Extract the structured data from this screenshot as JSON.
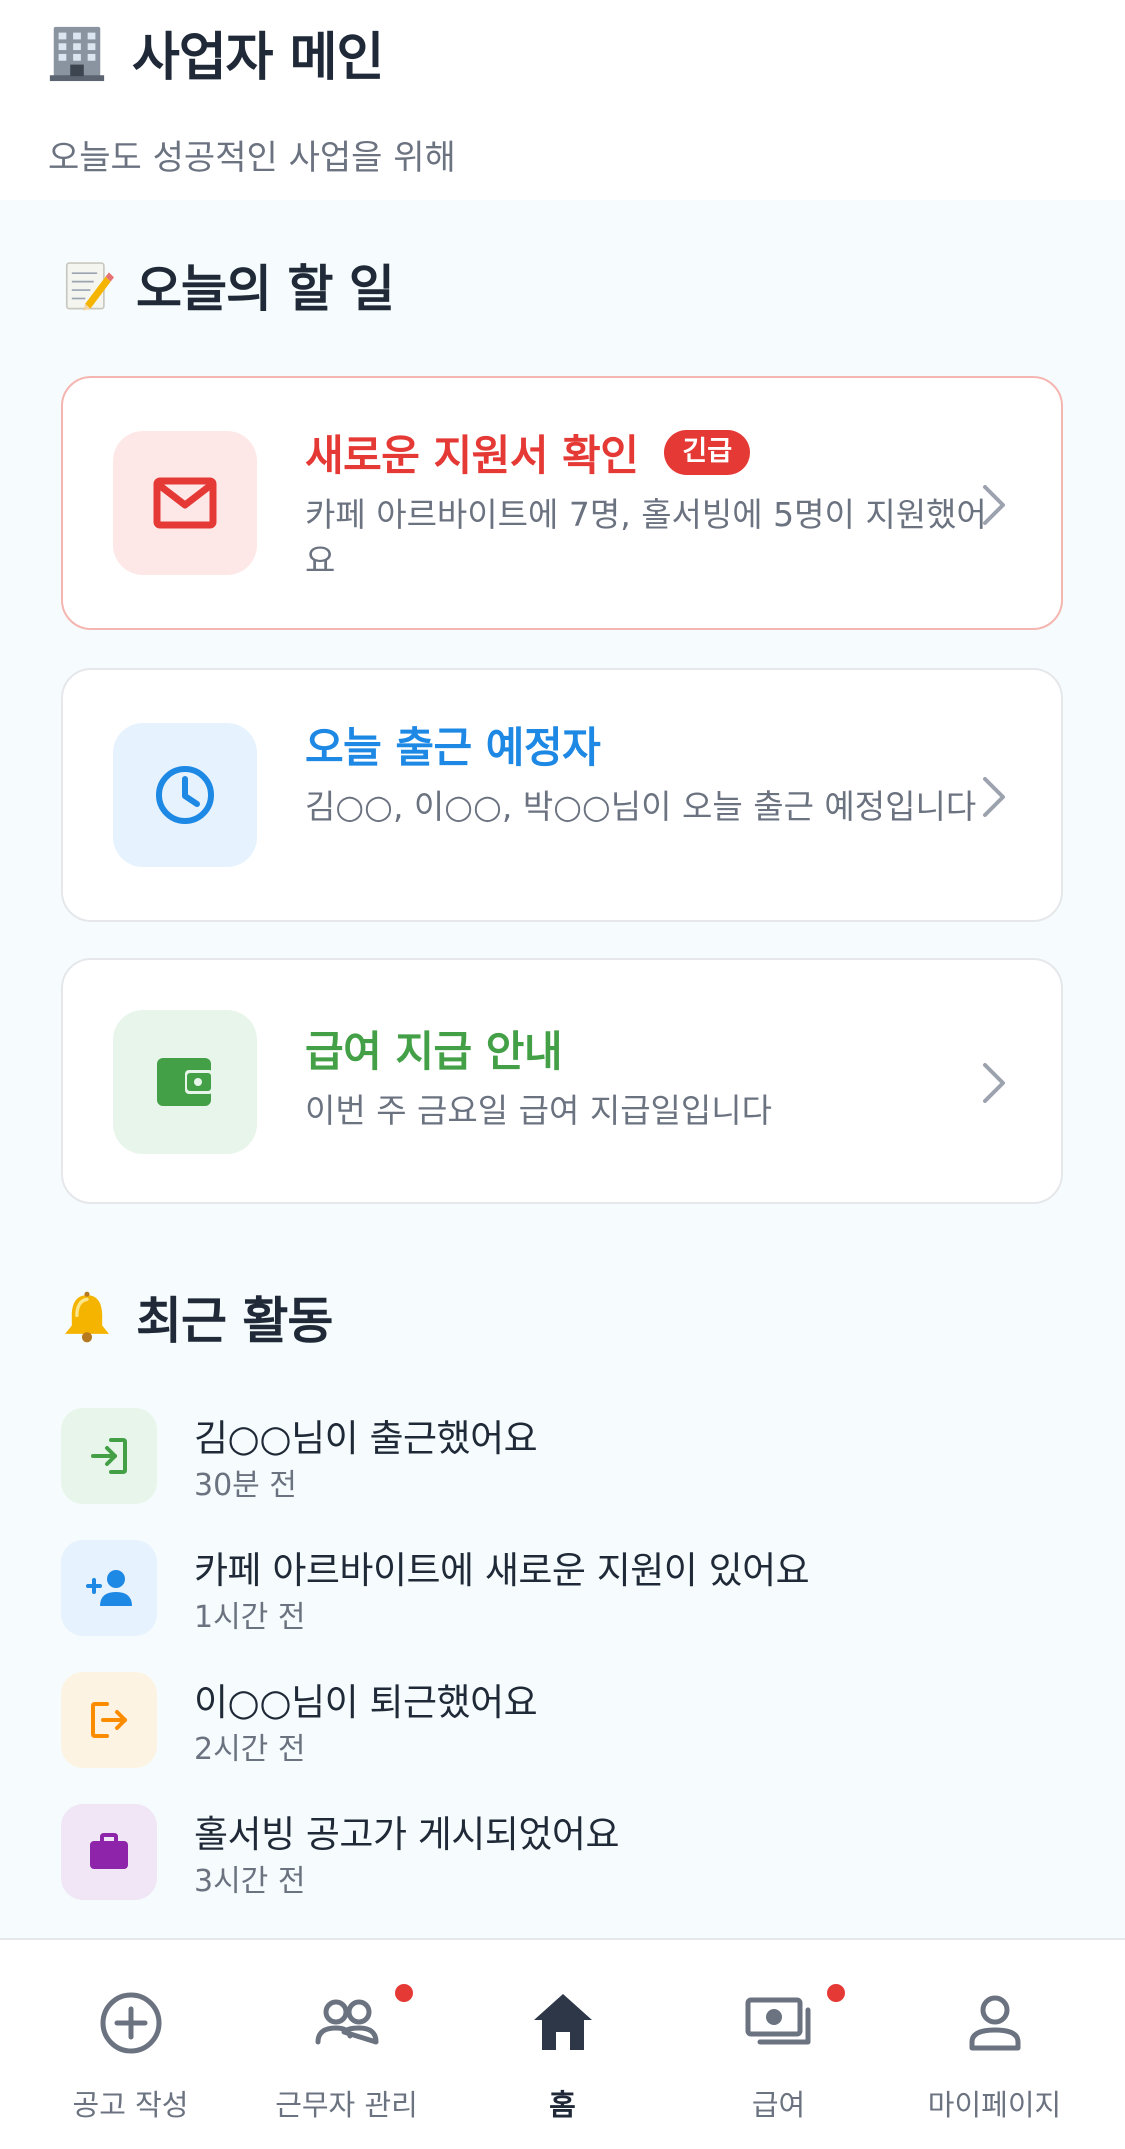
{
  "header": {
    "title": "사업자 메인",
    "subtitle": "오늘도 성공적인 사업을 위해",
    "icon": "office-building-emoji"
  },
  "todo": {
    "title": "오늘의 할 일",
    "icon": "memo-emoji",
    "cards": [
      {
        "title": "새로운 지원서 확인",
        "badge": "긴급",
        "description": "카페 아르바이트에 7명, 홀서빙에 5명이 지원했어요",
        "icon": "mail-icon",
        "color": "#e53935",
        "icon_bg": "#fde8e7"
      },
      {
        "title": "오늘 출근 예정자",
        "description": "김○○, 이○○, 박○○님이 오늘 출근 예정입니다",
        "icon": "clock-icon",
        "color": "#1e88e5",
        "icon_bg": "#e6f2fd"
      },
      {
        "title": "급여 지급 안내",
        "description": "이번 주 금요일 급여 지급일입니다",
        "icon": "wallet-icon",
        "color": "#43a047",
        "icon_bg": "#e8f5ea"
      }
    ]
  },
  "activity": {
    "title": "최근 활동",
    "icon": "bell-emoji",
    "items": [
      {
        "text": "김○○님이 출근했어요",
        "time": "30분 전",
        "icon": "login-icon",
        "color": "#43a047",
        "icon_bg": "#e8f5ea"
      },
      {
        "text": "카페 아르바이트에 새로운 지원이 있어요",
        "time": "1시간 전",
        "icon": "person-add-icon",
        "color": "#1e88e5",
        "icon_bg": "#e6f2fd"
      },
      {
        "text": "이○○님이 퇴근했어요",
        "time": "2시간 전",
        "icon": "logout-icon",
        "color": "#fb8c00",
        "icon_bg": "#fdf3e3"
      },
      {
        "text": "홀서빙 공고가 게시되었어요",
        "time": "3시간 전",
        "icon": "briefcase-icon",
        "color": "#8e24aa",
        "icon_bg": "#f1e6f6"
      }
    ]
  },
  "nav": {
    "items": [
      {
        "label": "공고 작성",
        "icon": "plus-circle-icon",
        "dot": false,
        "active": false
      },
      {
        "label": "근무자 관리",
        "icon": "people-icon",
        "dot": true,
        "active": false
      },
      {
        "label": "홈",
        "icon": "home-icon",
        "dot": false,
        "active": true
      },
      {
        "label": "급여",
        "icon": "money-icon",
        "dot": true,
        "active": false
      },
      {
        "label": "마이페이지",
        "icon": "user-icon",
        "dot": false,
        "active": false
      }
    ],
    "active_color": "#1f2937",
    "inactive_color": "#6b7280",
    "dot_color": "#e53935"
  }
}
